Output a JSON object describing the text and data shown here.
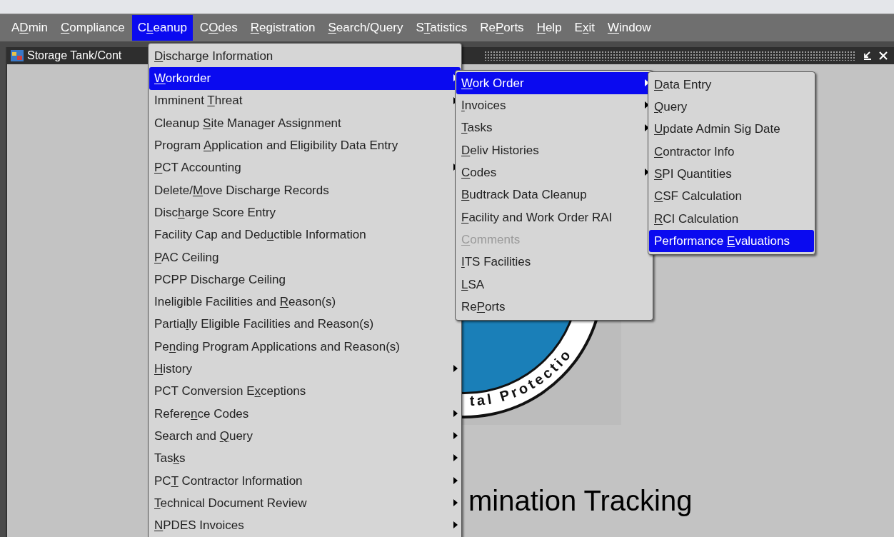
{
  "menubar": [
    {
      "label": {
        "before": "A",
        "mnemonic": "D",
        "after": "min"
      },
      "selected": false
    },
    {
      "label": {
        "mnemonic": "C",
        "after": "ompliance"
      },
      "selected": false
    },
    {
      "label": {
        "before": "C",
        "mnemonic": "L",
        "after": "eanup"
      },
      "selected": true
    },
    {
      "label": {
        "before": "C",
        "mnemonic": "O",
        "after": "des"
      },
      "selected": false
    },
    {
      "label": {
        "mnemonic": "R",
        "after": "egistration"
      },
      "selected": false
    },
    {
      "label": {
        "mnemonic": "S",
        "after": "earch/Query"
      },
      "selected": false
    },
    {
      "label": {
        "before": "S",
        "mnemonic": "T",
        "after": "atistics"
      },
      "selected": false
    },
    {
      "label": {
        "before": "Re",
        "mnemonic": "P",
        "after": "orts"
      },
      "selected": false
    },
    {
      "label": {
        "mnemonic": "H",
        "after": "elp"
      },
      "selected": false
    },
    {
      "label": {
        "before": "E",
        "mnemonic": "x",
        "after": "it"
      },
      "selected": false
    },
    {
      "label": {
        "mnemonic": "W",
        "after": "indow"
      },
      "selected": false
    }
  ],
  "window": {
    "title": "Storage Tank/Cont",
    "heading": "mination Tracking",
    "logo_text": "tal Protectio"
  },
  "menus": [
    {
      "items": [
        {
          "label": {
            "mnemonic": "D",
            "after": "ischarge Information"
          },
          "selected": false,
          "submenu": false,
          "disabled": false
        },
        {
          "label": {
            "mnemonic": "W",
            "after": "orkorder"
          },
          "selected": true,
          "submenu": true,
          "disabled": false
        },
        {
          "label": {
            "before": "Imminent ",
            "mnemonic": "T",
            "after": "hreat"
          },
          "selected": false,
          "submenu": true,
          "disabled": false
        },
        {
          "label": {
            "before": "Cleanup ",
            "mnemonic": "S",
            "after": "ite Manager Assignment"
          },
          "selected": false,
          "submenu": false,
          "disabled": false
        },
        {
          "label": {
            "before": "Program ",
            "mnemonic": "A",
            "after": "pplication and Eligibility Data Entry"
          },
          "selected": false,
          "submenu": false,
          "disabled": false
        },
        {
          "label": {
            "mnemonic": "P",
            "after": "CT Accounting"
          },
          "selected": false,
          "submenu": true,
          "disabled": false
        },
        {
          "label": {
            "before": "Delete/",
            "mnemonic": "M",
            "after": "ove Discharge Records"
          },
          "selected": false,
          "submenu": false,
          "disabled": false
        },
        {
          "label": {
            "before": "Disc",
            "mnemonic": "h",
            "after": "arge Score Entry"
          },
          "selected": false,
          "submenu": false,
          "disabled": false
        },
        {
          "label": {
            "before": "Facility Cap and Ded",
            "mnemonic": "u",
            "after": "ctible Information"
          },
          "selected": false,
          "submenu": false,
          "disabled": false
        },
        {
          "label": {
            "mnemonic": "P",
            "after": "AC Ceiling"
          },
          "selected": false,
          "submenu": false,
          "disabled": false
        },
        {
          "label": {
            "before": "PCPP Discharge Ceiling"
          },
          "selected": false,
          "submenu": false,
          "disabled": false
        },
        {
          "label": {
            "before": "Ineligible Facilities and ",
            "mnemonic": "R",
            "after": "eason(s)"
          },
          "selected": false,
          "submenu": false,
          "disabled": false
        },
        {
          "label": {
            "before": "Partia",
            "mnemonic": "l",
            "after": "ly Eligible Facilities and Reason(s)"
          },
          "selected": false,
          "submenu": false,
          "disabled": false
        },
        {
          "label": {
            "before": "Pe",
            "mnemonic": "n",
            "after": "ding Program Applications and Reason(s)"
          },
          "selected": false,
          "submenu": false,
          "disabled": false
        },
        {
          "label": {
            "mnemonic": "H",
            "after": "istory"
          },
          "selected": false,
          "submenu": true,
          "disabled": false
        },
        {
          "label": {
            "before": "PCT Conversion E",
            "mnemonic": "x",
            "after": "ceptions"
          },
          "selected": false,
          "submenu": false,
          "disabled": false
        },
        {
          "label": {
            "before": "Refere",
            "mnemonic": "n",
            "after": "ce Codes"
          },
          "selected": false,
          "submenu": true,
          "disabled": false
        },
        {
          "label": {
            "before": "Search and ",
            "mnemonic": "Q",
            "after": "uery"
          },
          "selected": false,
          "submenu": true,
          "disabled": false
        },
        {
          "label": {
            "before": "Tas",
            "mnemonic": "k",
            "after": "s"
          },
          "selected": false,
          "submenu": true,
          "disabled": false
        },
        {
          "label": {
            "before": "PC",
            "mnemonic": "T",
            "after": " Contractor Information"
          },
          "selected": false,
          "submenu": true,
          "disabled": false
        },
        {
          "label": {
            "mnemonic": "T",
            "after": "echnical Document Review"
          },
          "selected": false,
          "submenu": true,
          "disabled": false
        },
        {
          "label": {
            "mnemonic": "N",
            "after": "PDES Invoices"
          },
          "selected": false,
          "submenu": true,
          "disabled": false
        }
      ]
    },
    {
      "items": [
        {
          "label": {
            "mnemonic": "W",
            "after": "ork Order"
          },
          "selected": true,
          "submenu": true,
          "disabled": false
        },
        {
          "label": {
            "mnemonic": "I",
            "after": "nvoices"
          },
          "selected": false,
          "submenu": true,
          "disabled": false
        },
        {
          "label": {
            "mnemonic": "T",
            "after": "asks"
          },
          "selected": false,
          "submenu": true,
          "disabled": false
        },
        {
          "label": {
            "mnemonic": "D",
            "after": "eliv Histories"
          },
          "selected": false,
          "submenu": false,
          "disabled": false
        },
        {
          "label": {
            "mnemonic": "C",
            "after": "odes"
          },
          "selected": false,
          "submenu": true,
          "disabled": false
        },
        {
          "label": {
            "mnemonic": "B",
            "after": "udtrack Data Cleanup"
          },
          "selected": false,
          "submenu": false,
          "disabled": false
        },
        {
          "label": {
            "mnemonic": "F",
            "after": "acility and Work Order RAI"
          },
          "selected": false,
          "submenu": false,
          "disabled": false
        },
        {
          "label": {
            "mnemonic": "C",
            "after": "omments"
          },
          "selected": false,
          "submenu": false,
          "disabled": true
        },
        {
          "label": {
            "mnemonic": "I",
            "after": "TS Facilities"
          },
          "selected": false,
          "submenu": false,
          "disabled": false
        },
        {
          "label": {
            "mnemonic": "L",
            "after": "SA"
          },
          "selected": false,
          "submenu": false,
          "disabled": false
        },
        {
          "label": {
            "before": "Re",
            "mnemonic": "P",
            "after": "orts"
          },
          "selected": false,
          "submenu": false,
          "disabled": false
        }
      ]
    },
    {
      "items": [
        {
          "label": {
            "mnemonic": "D",
            "after": "ata Entry"
          },
          "selected": false,
          "submenu": false,
          "disabled": false
        },
        {
          "label": {
            "mnemonic": "Q",
            "after": "uery"
          },
          "selected": false,
          "submenu": false,
          "disabled": false
        },
        {
          "label": {
            "mnemonic": "U",
            "after": "pdate Admin Sig Date"
          },
          "selected": false,
          "submenu": false,
          "disabled": false
        },
        {
          "label": {
            "mnemonic": "C",
            "after": "ontractor Info"
          },
          "selected": false,
          "submenu": false,
          "disabled": false
        },
        {
          "label": {
            "mnemonic": "S",
            "after": "PI Quantities"
          },
          "selected": false,
          "submenu": false,
          "disabled": false
        },
        {
          "label": {
            "mnemonic": "C",
            "after": "SF Calculation"
          },
          "selected": false,
          "submenu": false,
          "disabled": false
        },
        {
          "label": {
            "mnemonic": "R",
            "after": "CI Calculation"
          },
          "selected": false,
          "submenu": false,
          "disabled": false
        },
        {
          "label": {
            "before": "Performance ",
            "mnemonic": "E",
            "after": "valuations"
          },
          "selected": true,
          "submenu": false,
          "disabled": false
        }
      ]
    }
  ]
}
